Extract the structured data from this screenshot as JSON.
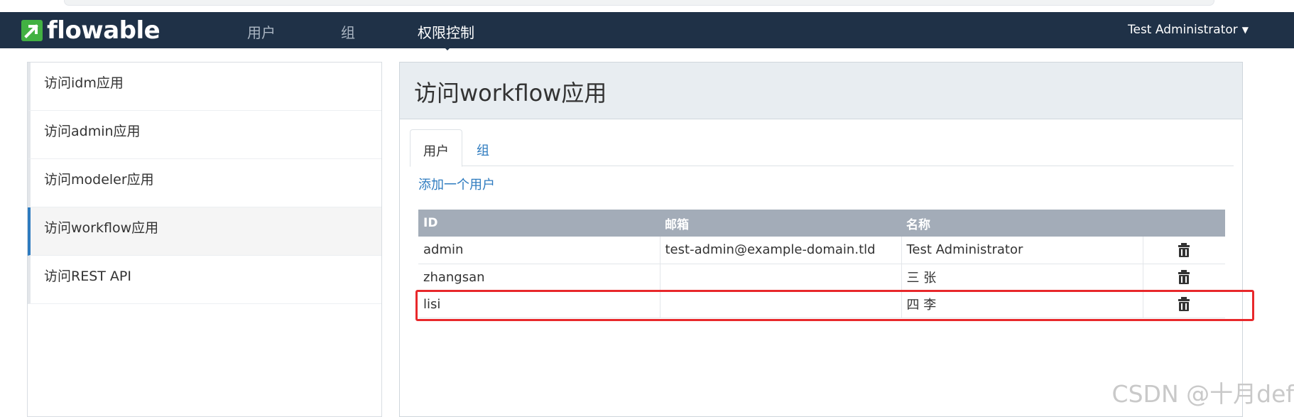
{
  "app": {
    "logo_text": "flowable"
  },
  "nav": {
    "items": [
      {
        "label": "用户"
      },
      {
        "label": "组"
      },
      {
        "label": "权限控制"
      }
    ],
    "user_menu": "Test Administrator"
  },
  "sidebar": {
    "items": [
      {
        "label": "访问idm应用"
      },
      {
        "label": "访问admin应用"
      },
      {
        "label": "访问modeler应用"
      },
      {
        "label": "访问workflow应用"
      },
      {
        "label": "访问REST API"
      }
    ]
  },
  "panel": {
    "title": "访问workflow应用",
    "tabs": [
      {
        "label": "用户"
      },
      {
        "label": "组"
      }
    ],
    "add_link": "添加一个用户",
    "table": {
      "headers": [
        "ID",
        "邮箱",
        "名称"
      ],
      "rows": [
        {
          "id": "admin",
          "email": "test-admin@example-domain.tld",
          "name": "Test Administrator"
        },
        {
          "id": "zhangsan",
          "email": "",
          "name": "三 张"
        },
        {
          "id": "lisi",
          "email": "",
          "name": "四 李"
        }
      ]
    }
  },
  "watermark": "CSDN @十月def",
  "colors": {
    "navbar": "#1f3147",
    "accent": "#2e7bbf",
    "highlight": "#e8282b",
    "table_header": "#a3acb8"
  }
}
